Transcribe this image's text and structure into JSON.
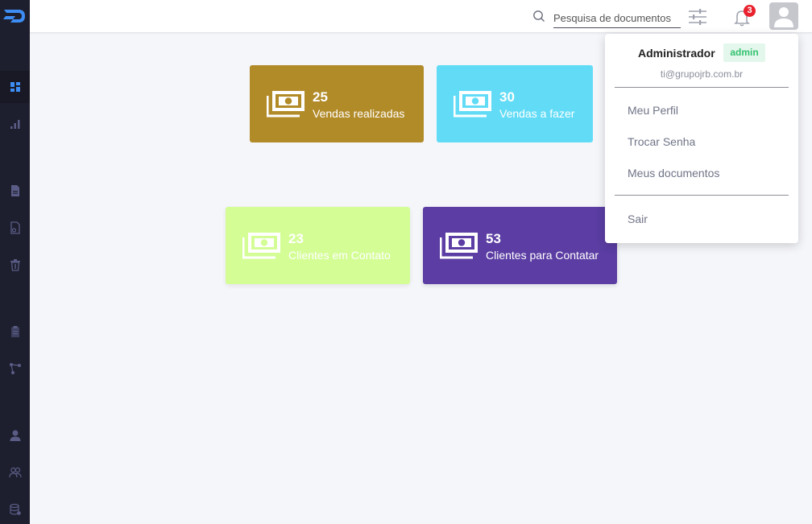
{
  "header": {
    "search": {
      "placeholder": "Pesquisa de documentos",
      "value": ""
    },
    "notifications": {
      "count": "3"
    }
  },
  "cards": [
    {
      "value": "25",
      "label": "Vendas realizadas"
    },
    {
      "value": "30",
      "label": "Vendas a fazer"
    },
    {
      "value": "23",
      "label": "Clientes em Contato"
    },
    {
      "value": "53",
      "label": "Clientes para Contatar"
    }
  ],
  "user_menu": {
    "name": "Administrador",
    "role": "admin",
    "email": "ti@grupojrb.com.br",
    "items": [
      {
        "label": "Meu Perfil"
      },
      {
        "label": "Trocar Senha"
      },
      {
        "label": "Meus documentos"
      }
    ],
    "logout": "Sair"
  },
  "colors": {
    "sidebar": "#1e1f2e",
    "card_1": "#b28b29",
    "card_2": "#62dcf6",
    "card_3": "#d4fd96",
    "card_4": "#5b3da3",
    "badge": "#e8222e",
    "accent": "#3d8df5"
  },
  "icons": {
    "logo": "logo-icon",
    "sidebar": [
      "dashboard-icon",
      "chart-icon",
      "document-icon",
      "document-settings-icon",
      "trash-icon",
      "clipboard-icon",
      "network-icon",
      "user-icon",
      "users-icon",
      "database-icon"
    ],
    "card": "money-icon"
  }
}
